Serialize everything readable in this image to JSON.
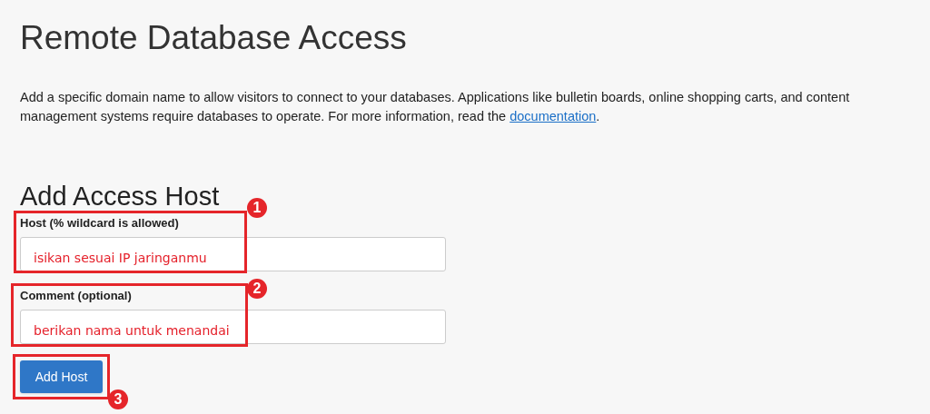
{
  "page": {
    "title": "Remote Database Access"
  },
  "intro": {
    "text": "Add a specific domain name to allow visitors to connect to your databases. Applications like bulletin boards, online shopping carts, and content management systems require databases to operate. For more information, read the ",
    "link": "documentation",
    "after": "."
  },
  "form": {
    "heading": "Add Access Host",
    "fields": [
      {
        "label": "Host (% wildcard is allowed)",
        "value": "isikan sesuai IP jaringanmu"
      },
      {
        "label": "Comment (optional)",
        "value": "berikan nama untuk menandai"
      }
    ],
    "button": "Add Host"
  },
  "annotations": [
    {
      "number": "1"
    },
    {
      "number": "2"
    },
    {
      "number": "3"
    }
  ]
}
